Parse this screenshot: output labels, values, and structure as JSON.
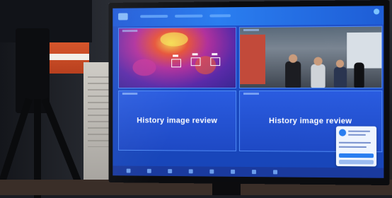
{
  "panes": [
    {
      "kind": "thermal"
    },
    {
      "kind": "camera"
    },
    {
      "kind": "review",
      "title": "History image review"
    },
    {
      "kind": "review",
      "title": "History image review"
    }
  ],
  "colors": {
    "screen_blue": "#1f4fc9",
    "thermal_hot": "#f3d24a",
    "thermal_cold": "#3a2693"
  },
  "icons": [
    "app-logo-icon",
    "close-icon",
    "avatar-icon"
  ]
}
